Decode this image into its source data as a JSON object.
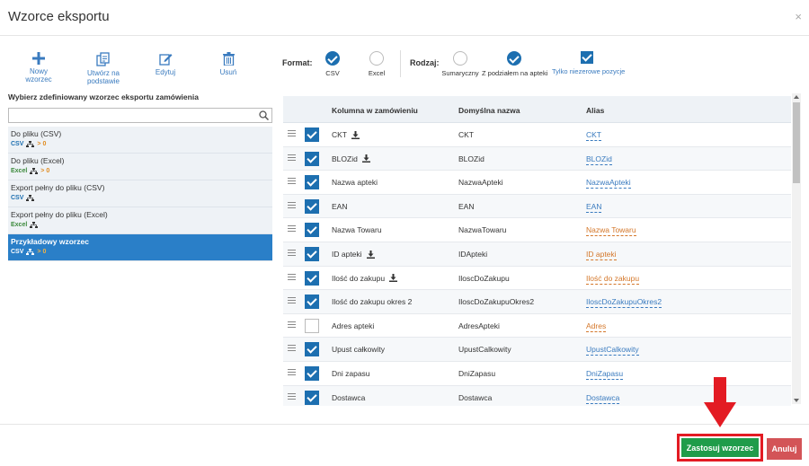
{
  "dialog": {
    "title": "Wzorce eksportu",
    "close_icon": "×"
  },
  "toolbar": {
    "new_template": "Nowy wzorzec",
    "create_based": "Utwórz na podstawie",
    "edit": "Edytuj",
    "delete": "Usuń"
  },
  "format": {
    "label": "Format:",
    "csv": "CSV",
    "excel": "Excel",
    "selected": "CSV"
  },
  "kind": {
    "label": "Rodzaj:",
    "summary": "Sumaryczny",
    "by_pharmacy": "Z podziałem na apteki",
    "nonzero_only": "Tylko niezerowe pozycje",
    "selected": "Z podziałem na apteki",
    "nonzero_checked": true
  },
  "templates_section": {
    "title": "Wybierz zdefiniowany wzorzec eksportu zamówienia",
    "search_placeholder": "",
    "items": [
      {
        "name": "Do pliku (CSV)",
        "format": "CSV",
        "extra": "> 0",
        "active": false
      },
      {
        "name": "Do pliku (Excel)",
        "format": "Excel",
        "extra": "> 0",
        "active": false
      },
      {
        "name": "Export pełny do pliku (CSV)",
        "format": "CSV",
        "extra": "",
        "active": false
      },
      {
        "name": "Export pełny do pliku (Excel)",
        "format": "Excel",
        "extra": "",
        "active": false
      },
      {
        "name": "Przykładowy wzorzec",
        "format": "CSV",
        "extra": "> 0",
        "active": true
      }
    ]
  },
  "columns_table": {
    "headers": [
      "Kolumna w zamówieniu",
      "Domyślna nazwa",
      "Alias"
    ],
    "rows": [
      {
        "column": "CKT",
        "download": true,
        "default": "CKT",
        "alias": "CKT",
        "alias_color": "blue",
        "checked": true
      },
      {
        "column": "BLOZid",
        "download": true,
        "default": "BLOZid",
        "alias": "BLOZid",
        "alias_color": "blue",
        "checked": true
      },
      {
        "column": "Nazwa apteki",
        "download": false,
        "default": "NazwaApteki",
        "alias": "NazwaApteki",
        "alias_color": "blue",
        "checked": true
      },
      {
        "column": "EAN",
        "download": false,
        "default": "EAN",
        "alias": "EAN",
        "alias_color": "blue",
        "checked": true
      },
      {
        "column": "Nazwa Towaru",
        "download": false,
        "default": "NazwaTowaru",
        "alias": "Nazwa Towaru",
        "alias_color": "orange",
        "checked": true
      },
      {
        "column": "ID apteki",
        "download": true,
        "default": "IDApteki",
        "alias": "ID apteki",
        "alias_color": "orange",
        "checked": true
      },
      {
        "column": "Ilość do zakupu",
        "download": true,
        "default": "IloscDoZakupu",
        "alias": "Ilość do zakupu",
        "alias_color": "orange",
        "checked": true
      },
      {
        "column": "Ilość do zakupu okres 2",
        "download": false,
        "default": "IloscDoZakupuOkres2",
        "alias": "IloscDoZakupuOkres2",
        "alias_color": "blue",
        "checked": true
      },
      {
        "column": "Adres apteki",
        "download": false,
        "default": "AdresApteki",
        "alias": "Adres",
        "alias_color": "orange",
        "checked": false
      },
      {
        "column": "Upust całkowity",
        "download": false,
        "default": "UpustCalkowity",
        "alias": "UpustCalkowity",
        "alias_color": "blue",
        "checked": true
      },
      {
        "column": "Dni zapasu",
        "download": false,
        "default": "DniZapasu",
        "alias": "DniZapasu",
        "alias_color": "blue",
        "checked": true
      },
      {
        "column": "Dostawca",
        "download": false,
        "default": "Dostawca",
        "alias": "Dostawca",
        "alias_color": "blue",
        "checked": true
      },
      {
        "column": "",
        "download": false,
        "default": "",
        "alias": "",
        "alias_color": "blue",
        "checked": true
      }
    ]
  },
  "footer": {
    "apply": "Zastosuj wzorzec",
    "cancel": "Anuluj"
  },
  "colors": {
    "accent": "#1d6fb0",
    "apply_green": "#1f9c4a",
    "cancel_red": "#d35457",
    "highlight_red": "#e31b23",
    "alias_blue": "#3a7bbf",
    "alias_orange": "#d4772a"
  },
  "icons": {
    "new_template": "plus-icon",
    "create_based": "copy-icon",
    "edit": "edit-icon",
    "delete": "trash-icon",
    "search": "search-icon",
    "download": "download-icon",
    "hierarchy": "hierarchy-icon",
    "drag": "drag-handle-icon",
    "arrow": "arrow-down-icon"
  }
}
